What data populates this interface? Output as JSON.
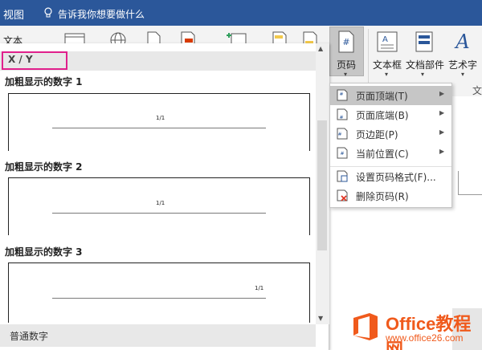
{
  "topbar": {
    "view_tab": "视图",
    "tell_me": "告诉我你想要做什么"
  },
  "ribbon": {
    "partial_label": "文本",
    "page_number_label": "页码",
    "textbox_label": "文本框",
    "quickparts_label": "文档部件",
    "wordart_label": "艺术字",
    "group_label_partial": "文"
  },
  "gallery": {
    "header_label": "X / Y",
    "sections": [
      {
        "title": "加粗显示的数字 1",
        "sample": "1/1",
        "align": "center"
      },
      {
        "title": "加粗显示的数字 2",
        "sample": "1/1",
        "align": "center"
      },
      {
        "title": "加粗显示的数字 3",
        "sample": "1/1",
        "align": "right"
      }
    ],
    "footer_label": "普通数字"
  },
  "menu": {
    "items": [
      {
        "label": "页面顶端(T)",
        "submenu": true,
        "highlighted": true
      },
      {
        "label": "页面底端(B)",
        "submenu": true
      },
      {
        "label": "页边距(P)",
        "submenu": true
      },
      {
        "label": "当前位置(C)",
        "submenu": true
      },
      {
        "label": "设置页码格式(F)...",
        "submenu": false
      },
      {
        "label": "删除页码(R)",
        "submenu": false
      }
    ]
  },
  "logo": {
    "name": "Office教程网",
    "url": "www.office26.com"
  },
  "colors": {
    "titlebar": "#2b579a",
    "highlight_box": "#e0208c",
    "logo_orange": "#f05a1c"
  }
}
